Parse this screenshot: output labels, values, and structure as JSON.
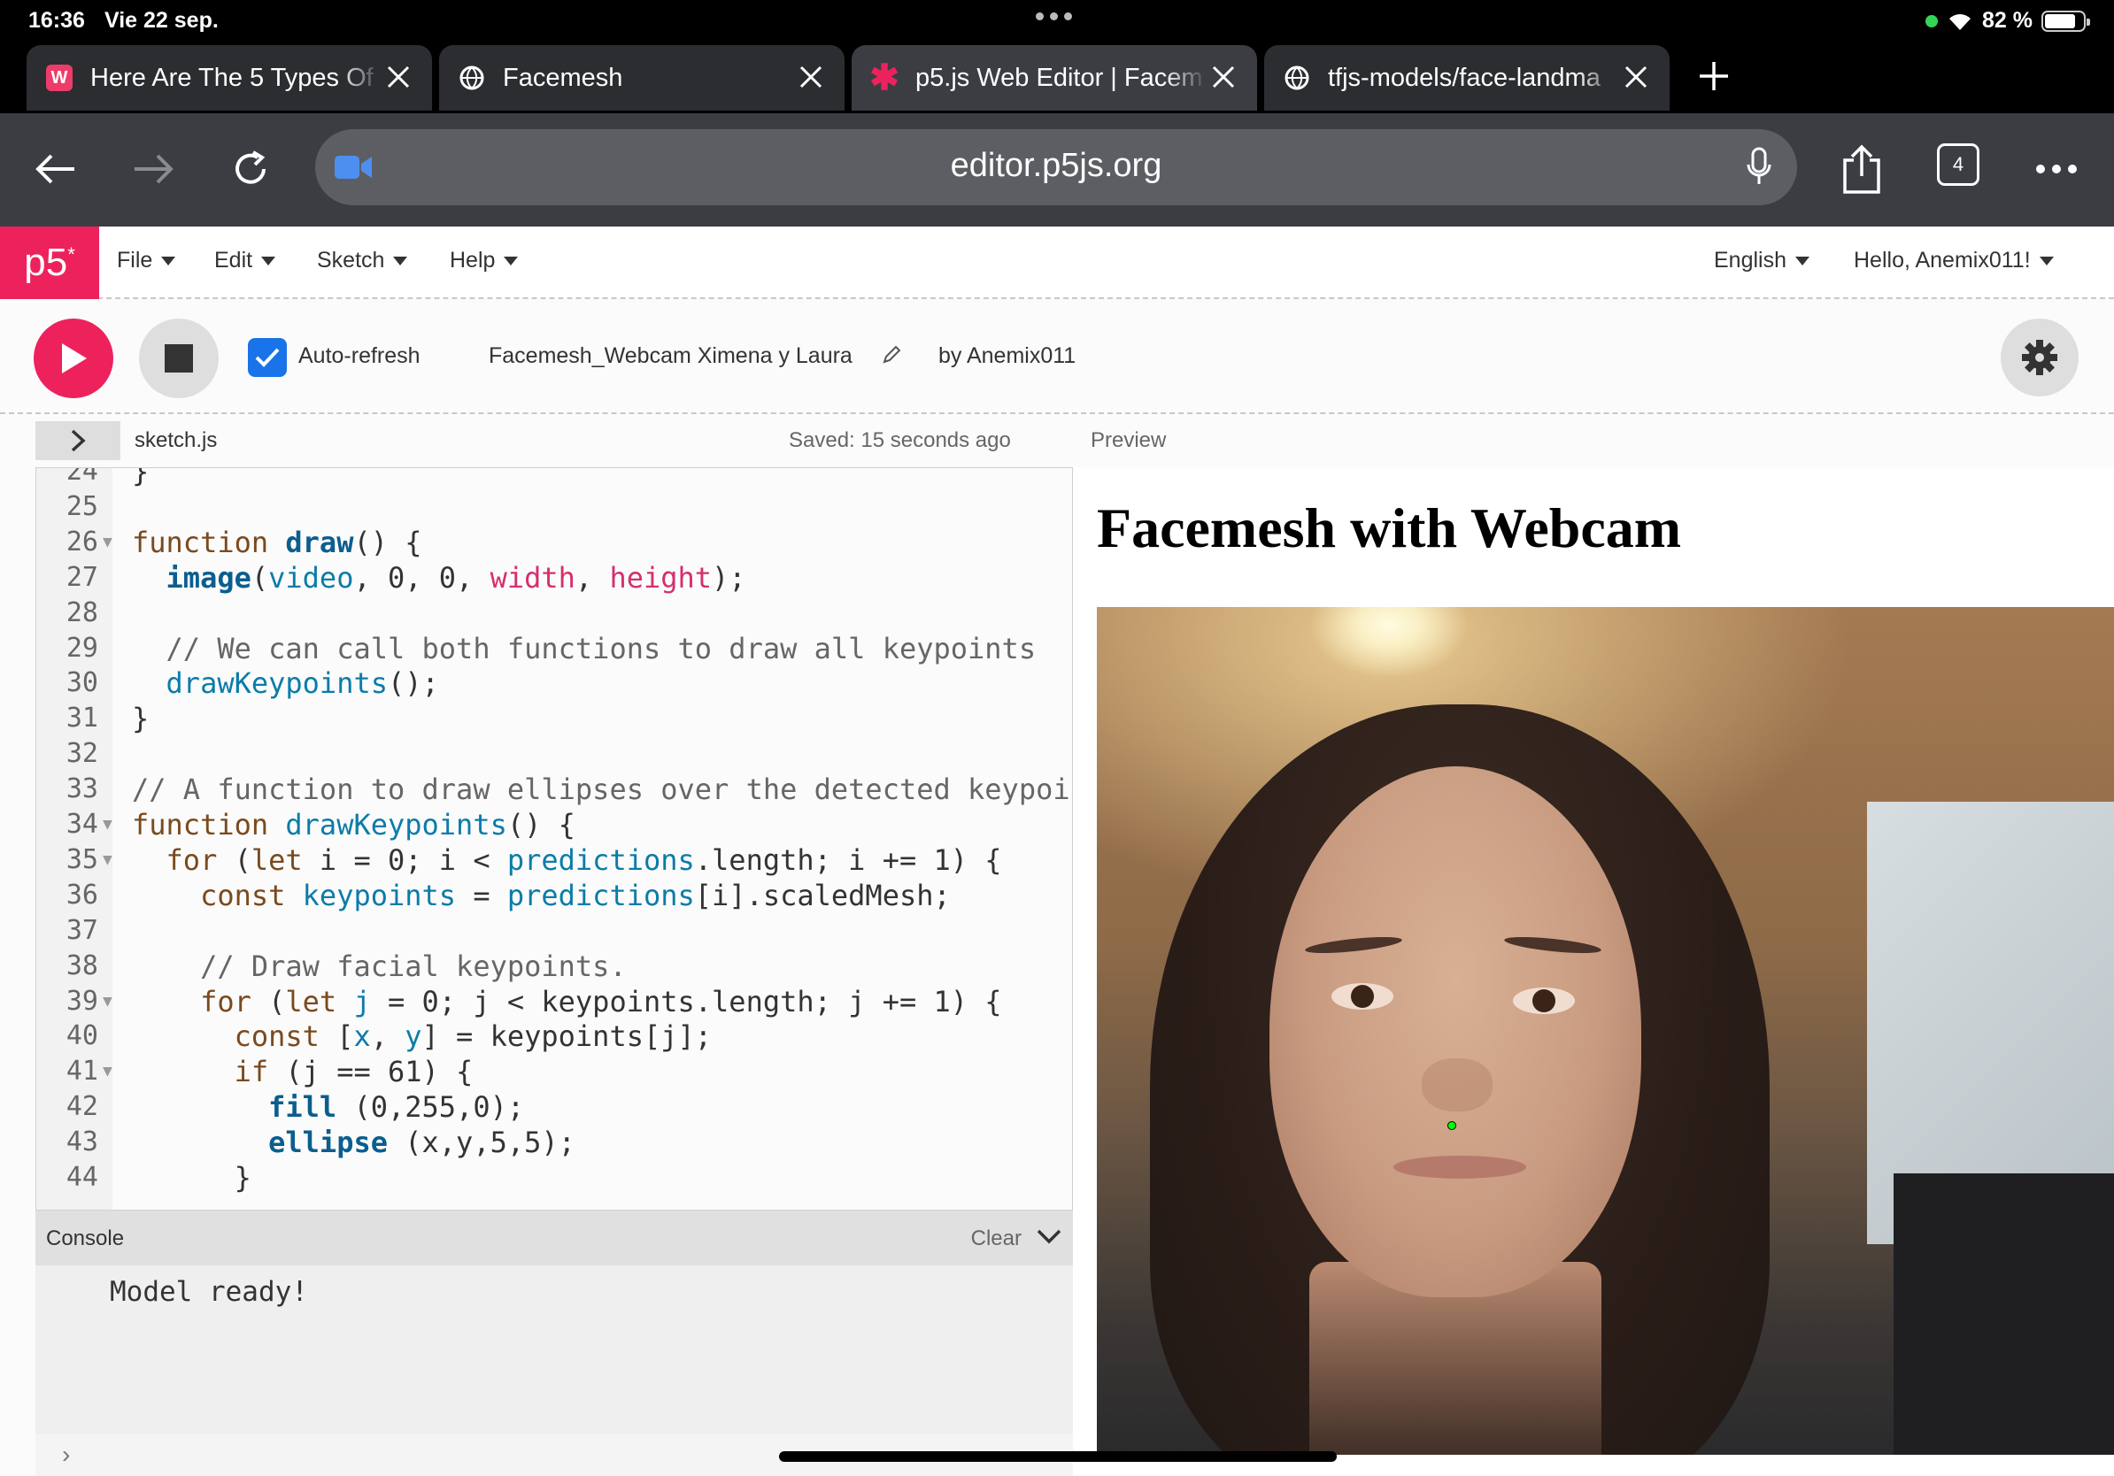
{
  "status_bar": {
    "time": "16:36",
    "date": "Vie 22 sep.",
    "battery": "82 %"
  },
  "tabs": [
    {
      "title": "Here Are The 5 Types Of",
      "favicon": "W",
      "active": false
    },
    {
      "title": "Facemesh",
      "active": false
    },
    {
      "title": "p5.js Web Editor | Facem",
      "active": true
    },
    {
      "title": "tfjs-models/face-landma",
      "active": false
    }
  ],
  "address_bar": {
    "url": "editor.p5js.org",
    "tab_count": "4"
  },
  "p5_nav": {
    "logo": "p5",
    "logo_sup": "*",
    "menus": [
      "File",
      "Edit",
      "Sketch",
      "Help"
    ],
    "language": "English",
    "user": "Hello, Anemix011!"
  },
  "controls": {
    "auto_refresh_label": "Auto-refresh",
    "sketch_name": "Facemesh_Webcam Ximena y Laura",
    "author": "by Anemix011"
  },
  "file_header": {
    "filename": "sketch.js",
    "saved": "Saved: 15 seconds ago",
    "preview_label": "Preview"
  },
  "code_lines": [
    {
      "n": "24",
      "html": "}"
    },
    {
      "n": "25",
      "html": ""
    },
    {
      "n": "26",
      "fold": true,
      "html": "<span class=\"kw\">function</span> <span class=\"fnb\">draw</span>() {"
    },
    {
      "n": "27",
      "html": "  <span class=\"fnb\">image</span>(<span class=\"var\">video</span>, 0, 0, <span class=\"pink\">width</span>, <span class=\"pink\">height</span>);"
    },
    {
      "n": "28",
      "html": ""
    },
    {
      "n": "29",
      "html": "  <span class=\"cm\">// We can call both functions to draw all keypoints</span>"
    },
    {
      "n": "30",
      "html": "  <span class=\"fn\">drawKeypoints</span>();"
    },
    {
      "n": "31",
      "html": "}"
    },
    {
      "n": "32",
      "html": ""
    },
    {
      "n": "33",
      "html": "<span class=\"cm\">// A function to draw ellipses over the detected keypoints</span>"
    },
    {
      "n": "34",
      "fold": true,
      "html": "<span class=\"kw\">function</span> <span class=\"fn\">drawKeypoints</span>() {"
    },
    {
      "n": "35",
      "fold": true,
      "html": "  <span class=\"kw\">for</span> (<span class=\"kw\">let</span> i = 0; i &lt; <span class=\"var\">predictions</span>.length; i += 1) {"
    },
    {
      "n": "36",
      "html": "    <span class=\"kw\">const</span> <span class=\"var\">keypoints</span> = <span class=\"var\">predictions</span>[i].scaledMesh;"
    },
    {
      "n": "37",
      "html": ""
    },
    {
      "n": "38",
      "html": "    <span class=\"cm\">// Draw facial keypoints.</span>"
    },
    {
      "n": "39",
      "fold": true,
      "html": "    <span class=\"kw\">for</span> (<span class=\"kw\">let</span> <span class=\"var\">j</span> = 0; j &lt; keypoints.length; j += 1) {"
    },
    {
      "n": "40",
      "html": "      <span class=\"kw\">const</span> [<span class=\"var\">x</span>, <span class=\"var\">y</span>] = keypoints[j];"
    },
    {
      "n": "41",
      "fold": true,
      "html": "      <span class=\"kw\">if</span> (j == 61) {"
    },
    {
      "n": "42",
      "html": "        <span class=\"fnb\">fill</span> (0,255,0);"
    },
    {
      "n": "43",
      "html": "        <span class=\"fnb\">ellipse</span> (x,y,5,5);"
    },
    {
      "n": "44",
      "html": "      }"
    }
  ],
  "console": {
    "label": "Console",
    "clear_label": "Clear",
    "message": "Model ready!"
  },
  "preview": {
    "heading": "Facemesh with Webcam"
  },
  "colors": {
    "p5_pink": "#ed225d",
    "toolbar": "#3b3d42",
    "checkbox_blue": "#1a73e8",
    "keypoint": "#00ff00"
  }
}
